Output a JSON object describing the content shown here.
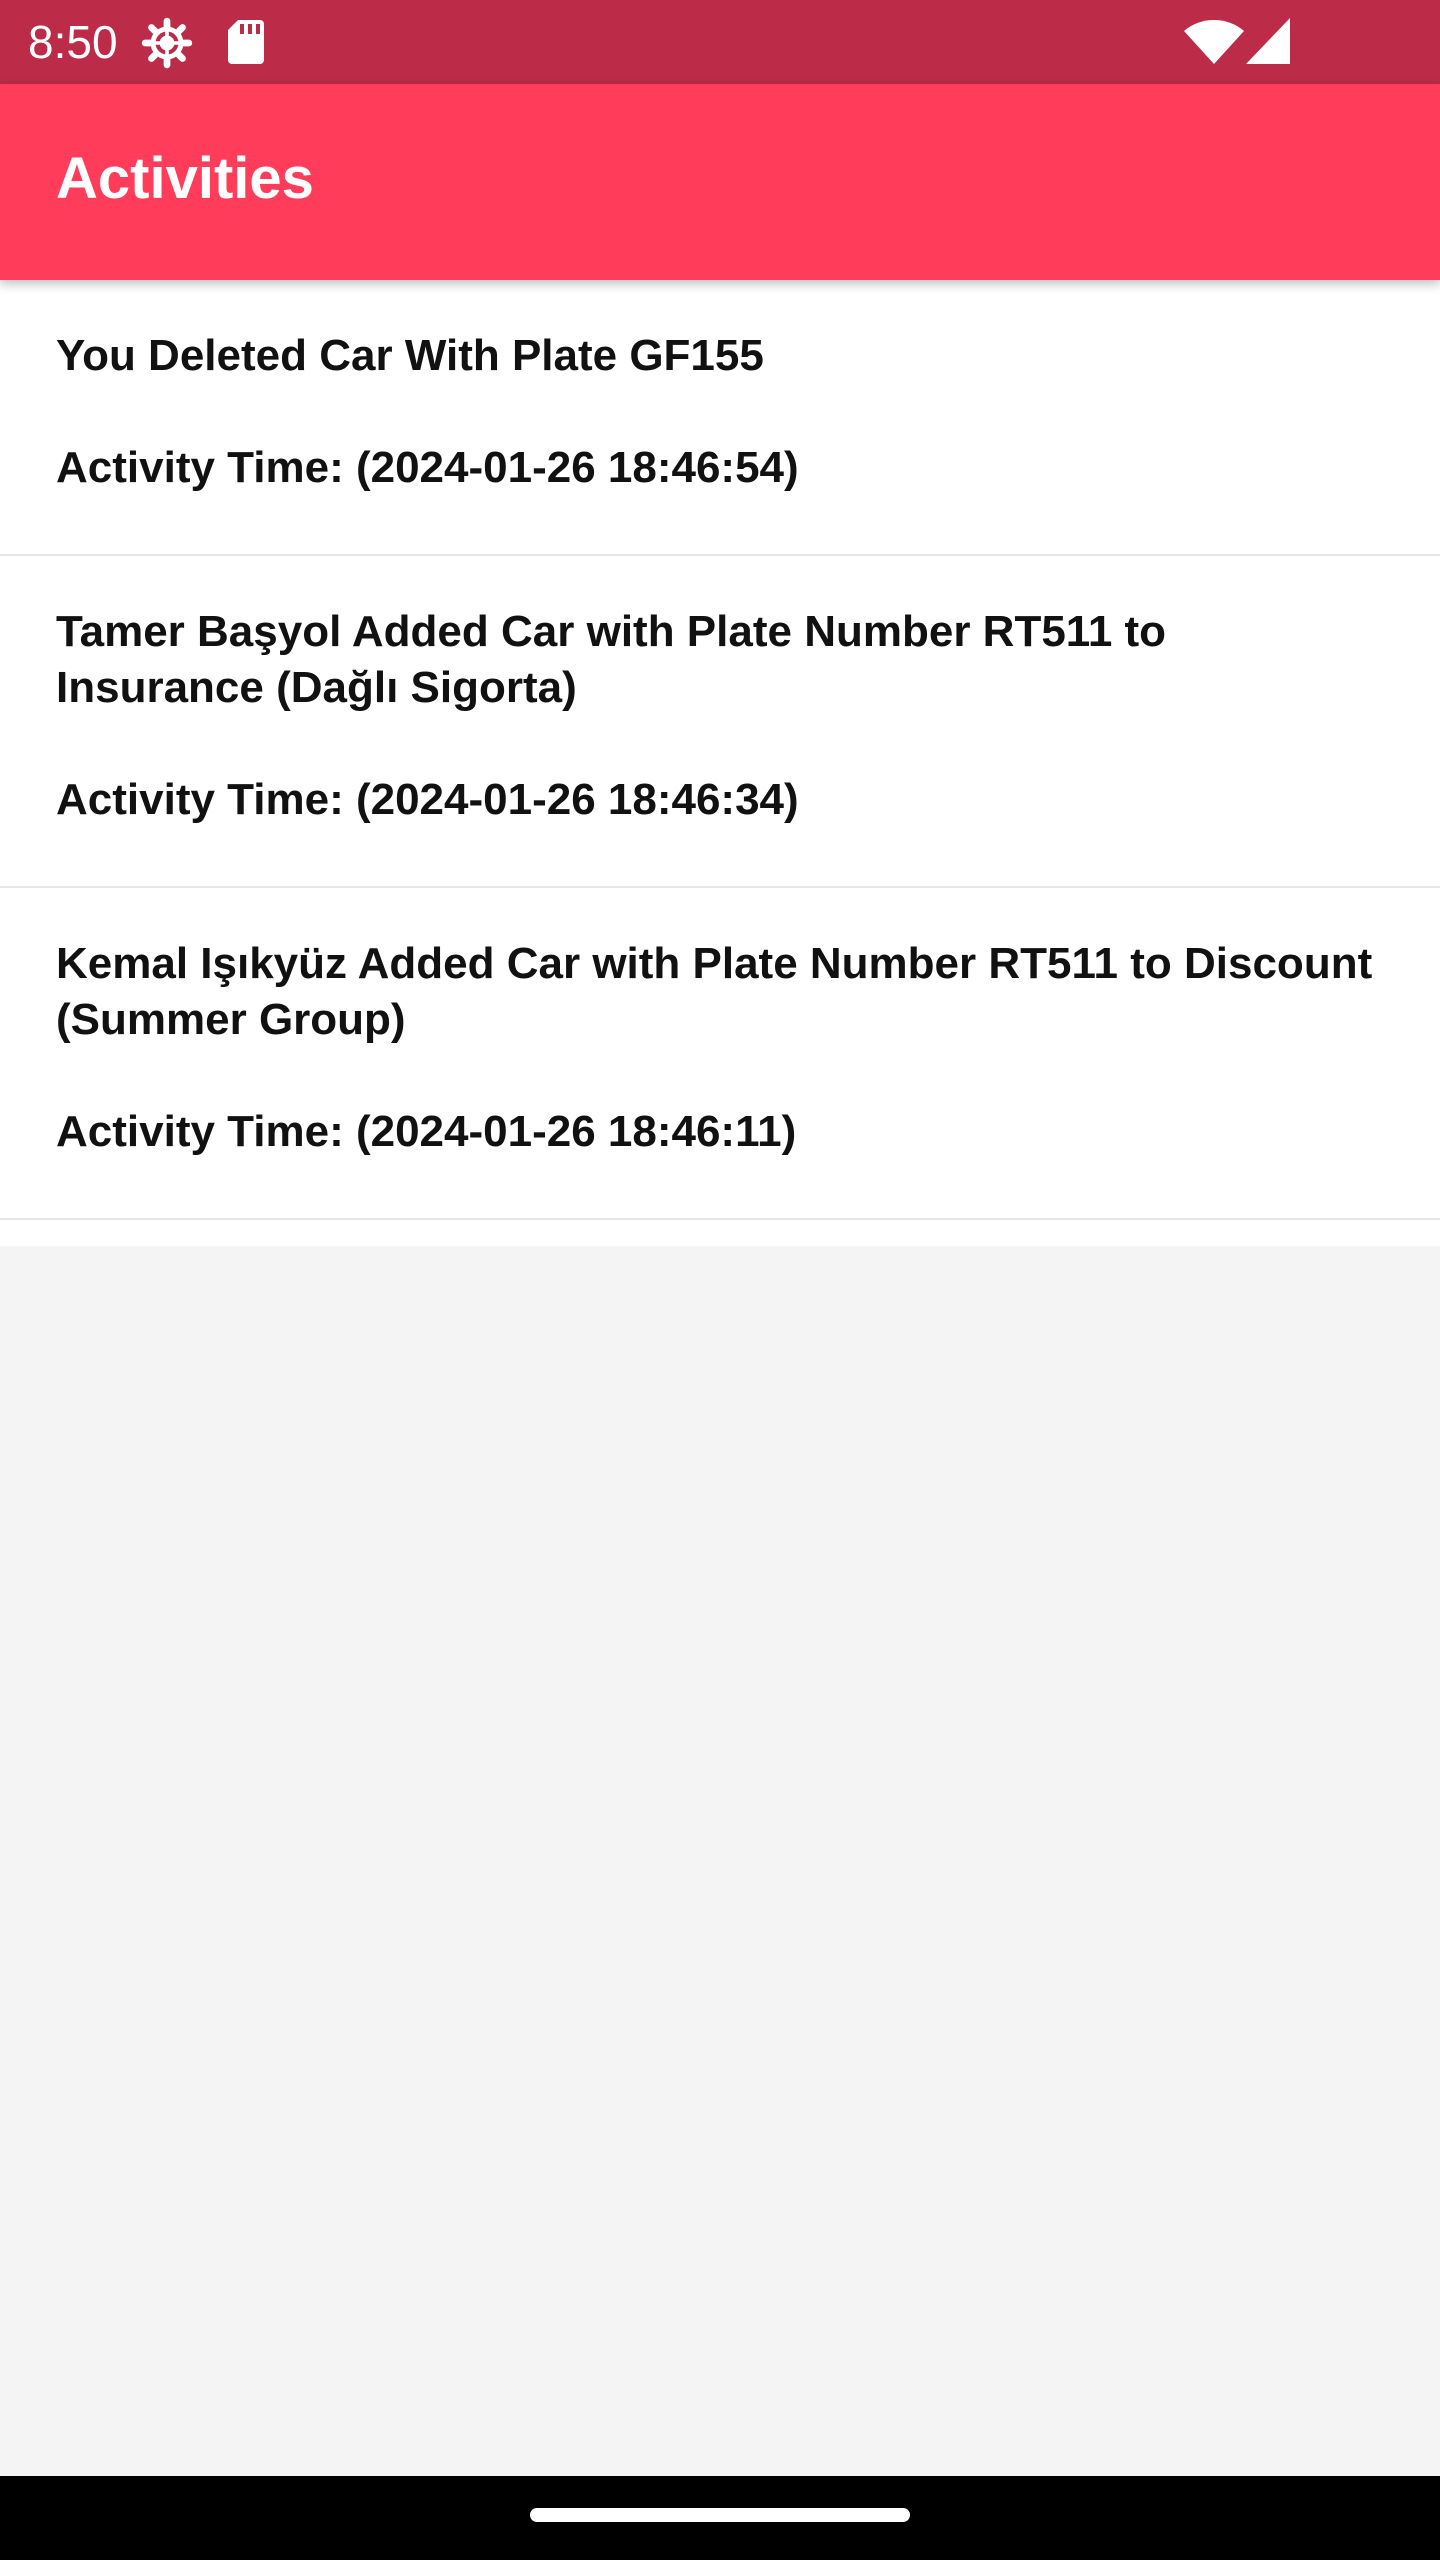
{
  "status_bar": {
    "time": "8:50",
    "background": "#bc2b47",
    "icons": [
      "settings-gear-icon",
      "sd-card-icon",
      "wifi-icon",
      "cellular-signal-icon"
    ]
  },
  "app_bar": {
    "title": "Activities",
    "background": "#ff3d5a"
  },
  "activities": [
    {
      "title": "You Deleted Car With Plate GF155",
      "time": "Activity Time: (2024-01-26 18:46:54)"
    },
    {
      "title": "Tamer Başyol Added Car with Plate Number RT511 to Insurance (Dağlı Sigorta)",
      "time": "Activity Time: (2024-01-26 18:46:34)"
    },
    {
      "title": "Kemal Işıkyüz Added Car with Plate Number RT511 to Discount (Summer Group)",
      "time": "Activity Time: (2024-01-26 18:46:11)"
    }
  ],
  "nav_bar": {
    "icons": [
      "home-handle-icon"
    ]
  }
}
